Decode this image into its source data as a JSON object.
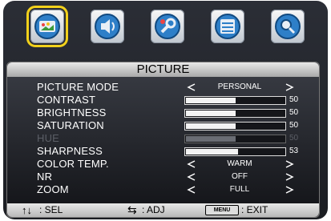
{
  "menu": {
    "icons": [
      {
        "name": "picture-icon",
        "active": true
      },
      {
        "name": "sound-icon",
        "active": false
      },
      {
        "name": "setup-icon",
        "active": false
      },
      {
        "name": "time-icon",
        "active": false
      },
      {
        "name": "search-icon",
        "active": false
      }
    ],
    "title": "PICTURE",
    "rows": [
      {
        "label": "PICTURE MODE",
        "type": "select",
        "value": "PERSONAL"
      },
      {
        "label": "CONTRAST",
        "type": "slider",
        "value": 50
      },
      {
        "label": "BRIGHTNESS",
        "type": "slider",
        "value": 50
      },
      {
        "label": "SATURATION",
        "type": "slider",
        "value": 50
      },
      {
        "label": "HUE",
        "type": "slider",
        "value": 50,
        "disabled": true
      },
      {
        "label": "SHARPNESS",
        "type": "slider",
        "value": 53
      },
      {
        "label": "COLOR TEMP.",
        "type": "select",
        "value": "WARM"
      },
      {
        "label": "NR",
        "type": "select",
        "value": "OFF"
      },
      {
        "label": "ZOOM",
        "type": "select",
        "value": "FULL"
      }
    ],
    "footer": {
      "sel_glyph": "↑↓",
      "sel_label": ": SEL",
      "adj_glyph": "⇆",
      "adj_label": ": ADJ",
      "menu_key": "MENU",
      "exit_label": ": EXIT"
    },
    "colors": {
      "highlight": "#f2d11b",
      "text": "#ffffff",
      "disabled": "#5b5e66"
    }
  }
}
